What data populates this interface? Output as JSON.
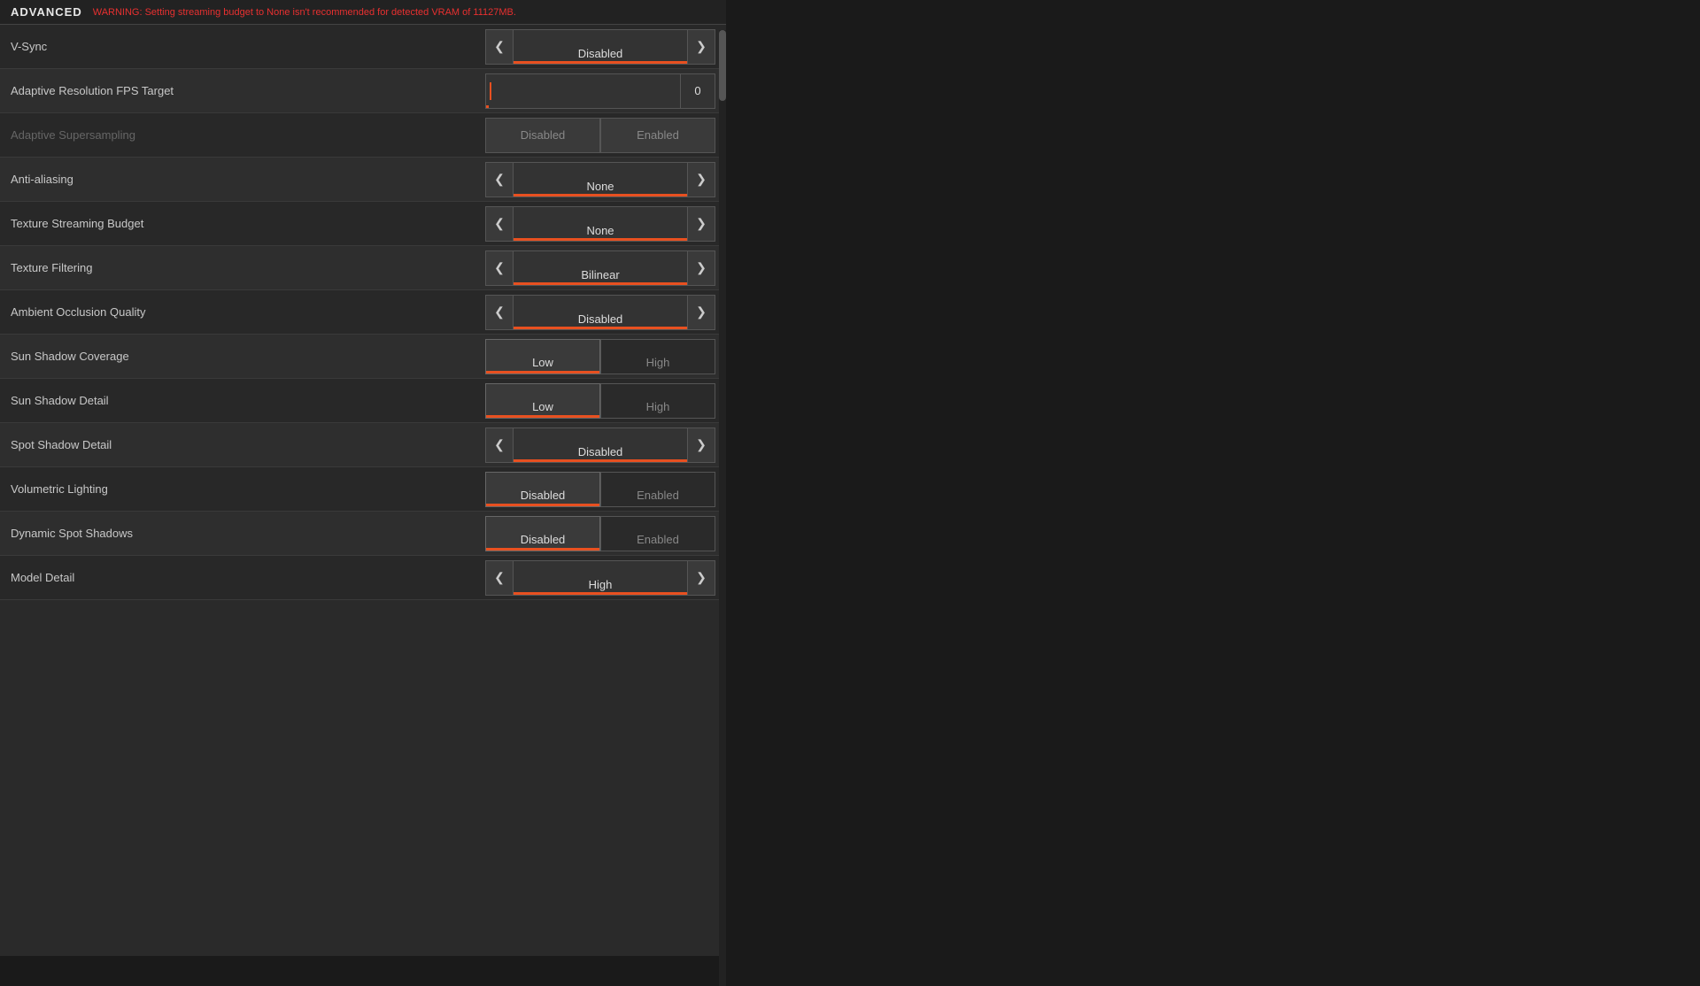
{
  "header": {
    "title": "ADVANCED",
    "warning": "WARNING: Setting streaming budget to None isn't recommended for detected VRAM of 11127MB."
  },
  "settings": [
    {
      "id": "vsync",
      "label": "V-Sync",
      "type": "arrow",
      "value": "Disabled",
      "dimmed": false
    },
    {
      "id": "adaptive-resolution",
      "label": "Adaptive Resolution FPS Target",
      "type": "fps",
      "value": "0",
      "dimmed": false
    },
    {
      "id": "adaptive-supersampling",
      "label": "Adaptive Supersampling",
      "type": "supersampling",
      "options": [
        "Disabled",
        "Enabled"
      ],
      "active": "Disabled",
      "dimmed": true
    },
    {
      "id": "anti-aliasing",
      "label": "Anti-aliasing",
      "type": "arrow",
      "value": "None",
      "dimmed": false
    },
    {
      "id": "texture-streaming",
      "label": "Texture Streaming Budget",
      "type": "arrow",
      "value": "None",
      "dimmed": false
    },
    {
      "id": "texture-filtering",
      "label": "Texture Filtering",
      "type": "arrow",
      "value": "Bilinear",
      "dimmed": false
    },
    {
      "id": "ambient-occlusion",
      "label": "Ambient Occlusion Quality",
      "type": "arrow",
      "value": "Disabled",
      "dimmed": false
    },
    {
      "id": "sun-shadow-coverage",
      "label": "Sun Shadow Coverage",
      "type": "toggle",
      "options": [
        "Low",
        "High"
      ],
      "active": "Low",
      "dimmed": false
    },
    {
      "id": "sun-shadow-detail",
      "label": "Sun Shadow Detail",
      "type": "toggle",
      "options": [
        "Low",
        "High"
      ],
      "active": "Low",
      "dimmed": false
    },
    {
      "id": "spot-shadow-detail",
      "label": "Spot Shadow Detail",
      "type": "arrow",
      "value": "Disabled",
      "dimmed": false
    },
    {
      "id": "volumetric-lighting",
      "label": "Volumetric Lighting",
      "type": "toggle",
      "options": [
        "Disabled",
        "Enabled"
      ],
      "active": "Disabled",
      "dimmed": false
    },
    {
      "id": "dynamic-spot-shadows",
      "label": "Dynamic Spot Shadows",
      "type": "toggle",
      "options": [
        "Disabled",
        "Enabled"
      ],
      "active": "Disabled",
      "dimmed": false
    },
    {
      "id": "model-detail",
      "label": "Model Detail",
      "type": "arrow-partial",
      "value": "High",
      "dimmed": false
    }
  ],
  "icons": {
    "left_arrow": "❮",
    "right_arrow": "❯"
  }
}
